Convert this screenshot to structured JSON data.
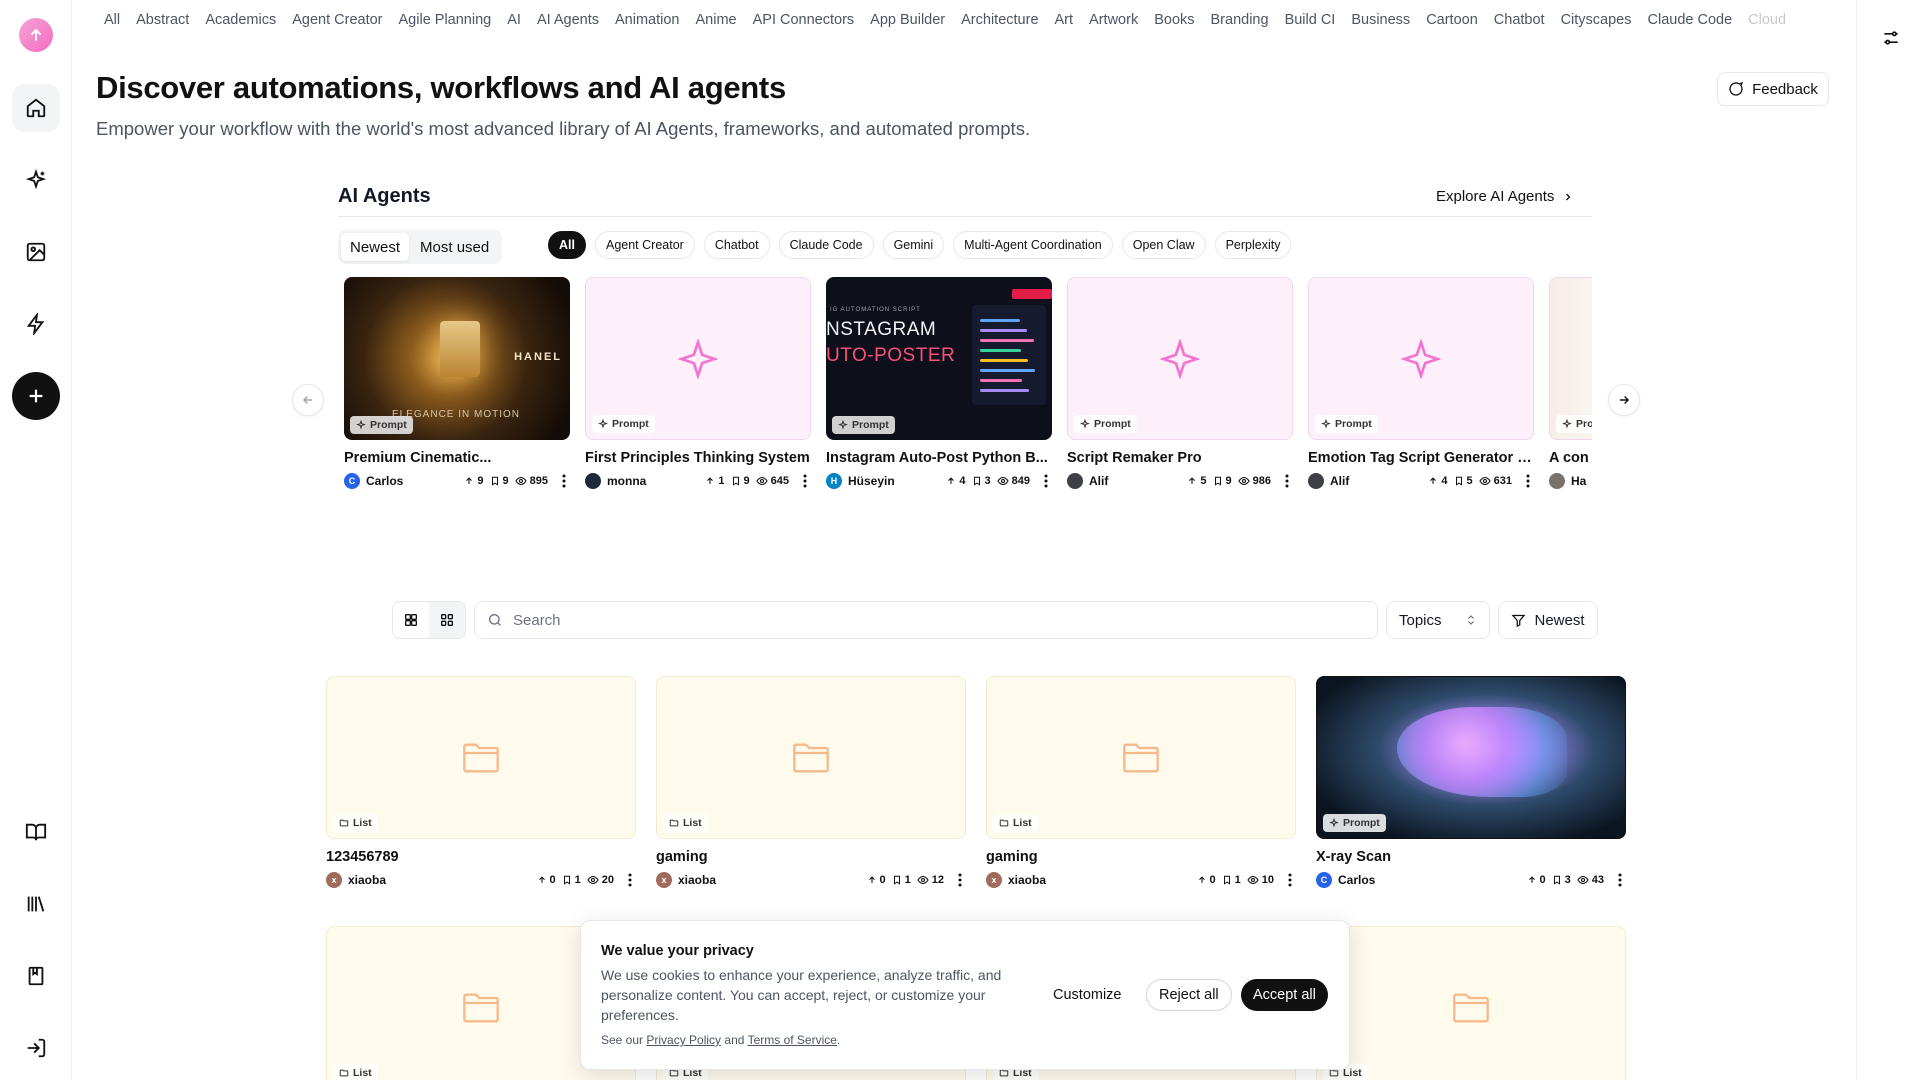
{
  "topics": [
    "All",
    "Abstract",
    "Academics",
    "Agent Creator",
    "Agile Planning",
    "AI",
    "AI Agents",
    "Animation",
    "Anime",
    "API Connectors",
    "App Builder",
    "Architecture",
    "Art",
    "Artwork",
    "Books",
    "Branding",
    "Build CI",
    "Business",
    "Cartoon",
    "Chatbot",
    "Cityscapes",
    "Claude Code",
    "Cloud"
  ],
  "header": {
    "title": "Discover automations, workflows and AI agents",
    "subtitle": "Empower your workflow with the world's most advanced library of AI Agents, frameworks, and automated prompts.",
    "feedback_label": "Feedback"
  },
  "agents": {
    "title": "AI Agents",
    "explore_label": "Explore AI Agents",
    "sort_options": [
      "Newest",
      "Most used"
    ],
    "filters": [
      "All",
      "Agent Creator",
      "Chatbot",
      "Claude Code",
      "Gemini",
      "Multi-Agent Coordination",
      "Open Claw",
      "Perplexity"
    ],
    "cards": [
      {
        "title": "Premium Cinematic...",
        "type": "Prompt",
        "author": "Carlos",
        "avatar": "C",
        "avatar_color": "#2563eb",
        "upvotes": "9",
        "saves": "9",
        "views": "895",
        "thumb": "perfume"
      },
      {
        "title": "First Principles Thinking System",
        "type": "Prompt",
        "author": "monna",
        "avatar": "",
        "avatar_color": "#1e293b",
        "upvotes": "1",
        "saves": "9",
        "views": "645",
        "thumb": "pink"
      },
      {
        "title": "Instagram Auto-Post Python B...",
        "type": "Prompt",
        "author": "Hüseyin",
        "avatar": "H",
        "avatar_color": "#0284c7",
        "upvotes": "4",
        "saves": "3",
        "views": "849",
        "thumb": "instagram"
      },
      {
        "title": "Script Remaker Pro",
        "type": "Prompt",
        "author": "Alif",
        "avatar": "",
        "avatar_color": "#3f3f46",
        "upvotes": "5",
        "saves": "9",
        "views": "986",
        "thumb": "pink"
      },
      {
        "title": "Emotion Tag Script Generator f...",
        "type": "Prompt",
        "author": "Alif",
        "avatar": "",
        "avatar_color": "#3f3f46",
        "upvotes": "4",
        "saves": "5",
        "views": "631",
        "thumb": "pink"
      },
      {
        "title": "A con",
        "type": "Pro",
        "author": "Ha",
        "avatar": "",
        "avatar_color": "#78716c",
        "upvotes": "",
        "saves": "",
        "views": "",
        "thumb": "partial"
      }
    ],
    "thumb_texts": {
      "perfume_brand": "HANEL",
      "perfume_tagline": "ELEGANCE IN MOTION",
      "insta_kicker": "IG AUTOMATION SCRIPT",
      "insta_line1": "NSTAGRAM",
      "insta_line2": "UTO-POSTER"
    }
  },
  "gallery": {
    "search_placeholder": "Search",
    "topics_label": "Topics",
    "sort_label": "Newest",
    "cards": [
      {
        "title": "123456789",
        "type": "List",
        "author": "xiaoba",
        "avatar": "x",
        "avatar_color": "#a16b5b",
        "upvotes": "0",
        "saves": "1",
        "views": "20",
        "thumb": "folder"
      },
      {
        "title": "gaming",
        "type": "List",
        "author": "xiaoba",
        "avatar": "x",
        "avatar_color": "#a16b5b",
        "upvotes": "0",
        "saves": "1",
        "views": "12",
        "thumb": "folder"
      },
      {
        "title": "gaming",
        "type": "List",
        "author": "xiaoba",
        "avatar": "x",
        "avatar_color": "#a16b5b",
        "upvotes": "0",
        "saves": "1",
        "views": "10",
        "thumb": "folder"
      },
      {
        "title": "X-ray Scan",
        "type": "Prompt",
        "author": "Carlos",
        "avatar": "C",
        "avatar_color": "#2563eb",
        "upvotes": "0",
        "saves": "3",
        "views": "43",
        "thumb": "xray"
      }
    ],
    "row2_badge": "List"
  },
  "cookie": {
    "title": "We value your privacy",
    "body": "We use cookies to enhance your experience, analyze traffic, and personalize content. You can accept, reject, or customize your preferences.",
    "foot_prefix": "See our",
    "privacy_link": "Privacy Policy",
    "foot_and": "and",
    "terms_link": "Terms of Service",
    "foot_end": ".",
    "customize_label": "Customize",
    "reject_label": "Reject all",
    "accept_label": "Accept all"
  },
  "colors": {
    "brand_pink": "#f36cc0",
    "folder_orange": "#f5b98a",
    "dark": "#111111"
  }
}
